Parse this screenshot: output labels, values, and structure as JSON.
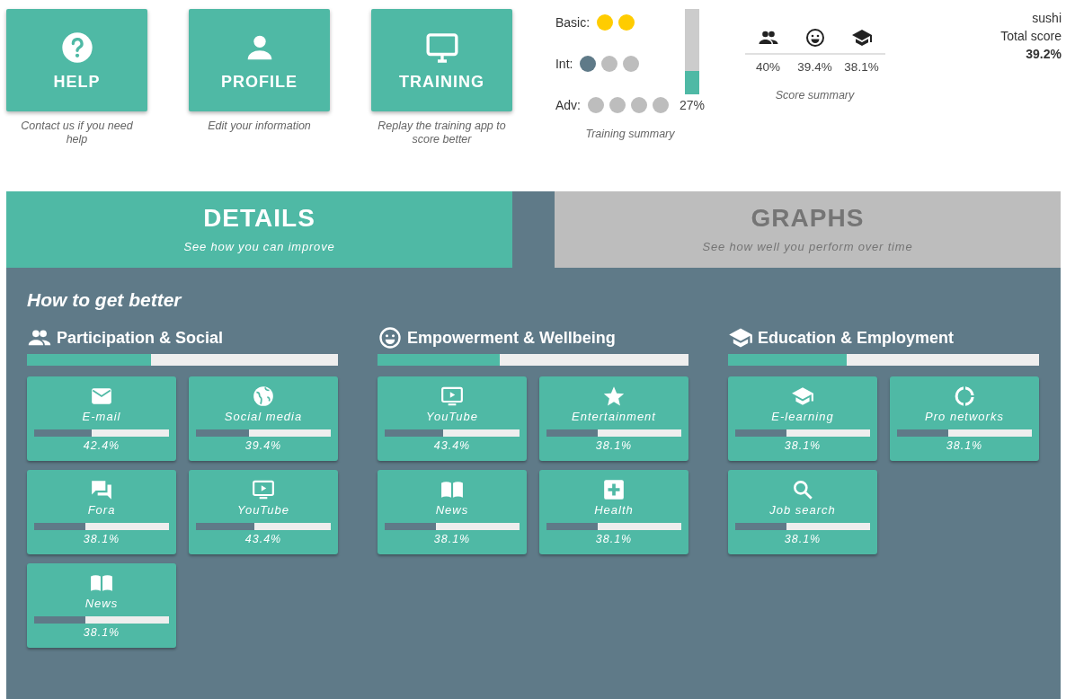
{
  "nav_buttons": [
    {
      "kind": "help",
      "label": "HELP",
      "caption": "Contact us if you need help"
    },
    {
      "kind": "profile",
      "label": "PROFILE",
      "caption": "Edit your information"
    },
    {
      "kind": "training",
      "label": "TRAINING",
      "caption": "Replay the training app to score better"
    }
  ],
  "training_summary": {
    "levels": [
      {
        "label": "Basic:",
        "dots": [
          {
            "color": "#ffcc00"
          },
          {
            "color": "#ffcc00"
          }
        ]
      },
      {
        "label": "Int:",
        "dots": [
          {
            "color": "#5f7a88"
          },
          {
            "color": "#bdbdbd"
          },
          {
            "color": "#bdbdbd"
          }
        ]
      },
      {
        "label": "Adv:",
        "dots": [
          {
            "color": "#bdbdbd"
          },
          {
            "color": "#bdbdbd"
          },
          {
            "color": "#bdbdbd"
          },
          {
            "color": "#bdbdbd"
          }
        ]
      }
    ],
    "progress": {
      "level": 0.27,
      "reading": "27%"
    },
    "caption": "Training summary"
  },
  "score_summary": {
    "scores": [
      {
        "kind": "people",
        "value": "40%"
      },
      {
        "kind": "smile",
        "value": "39.4%"
      },
      {
        "kind": "school",
        "value": "38.1%"
      }
    ],
    "caption": "Score summary"
  },
  "user": {
    "name": "sushi",
    "total_label": "Total score",
    "total": "39.2%"
  },
  "tabs": [
    {
      "title": "DETAILS",
      "subtitle": "See how you can improve",
      "selected": true
    },
    {
      "title": "GRAPHS",
      "subtitle": "See how well you perform over time",
      "selected": false
    }
  ],
  "details": {
    "heading": "How to get better",
    "sections": [
      {
        "kind": "people",
        "title": "Participation & Social",
        "level": 0.4,
        "tiles": [
          {
            "kind": "mail",
            "label": "E-mail",
            "level": 0.424,
            "reading": "42.4%"
          },
          {
            "kind": "globe",
            "label": "Social media",
            "level": 0.394,
            "reading": "39.4%"
          },
          {
            "kind": "forum",
            "label": "Fora",
            "level": 0.381,
            "reading": "38.1%"
          },
          {
            "kind": "tv",
            "label": "YouTube",
            "level": 0.434,
            "reading": "43.4%"
          },
          {
            "kind": "book",
            "label": "News",
            "level": 0.381,
            "reading": "38.1%"
          }
        ]
      },
      {
        "kind": "smile",
        "title": "Empowerment & Wellbeing",
        "level": 0.394,
        "tiles": [
          {
            "kind": "tv",
            "label": "YouTube",
            "level": 0.434,
            "reading": "43.4%"
          },
          {
            "kind": "star",
            "label": "Entertainment",
            "level": 0.381,
            "reading": "38.1%"
          },
          {
            "kind": "book",
            "label": "News",
            "level": 0.381,
            "reading": "38.1%"
          },
          {
            "kind": "health",
            "label": "Health",
            "level": 0.381,
            "reading": "38.1%"
          }
        ]
      },
      {
        "kind": "school",
        "title": "Education & Employment",
        "level": 0.381,
        "tiles": [
          {
            "kind": "school",
            "label": "E-learning",
            "level": 0.381,
            "reading": "38.1%"
          },
          {
            "kind": "ring",
            "label": "Pro networks",
            "level": 0.381,
            "reading": "38.1%"
          },
          {
            "kind": "search",
            "label": "Job search",
            "level": 0.381,
            "reading": "38.1%"
          }
        ]
      }
    ]
  }
}
